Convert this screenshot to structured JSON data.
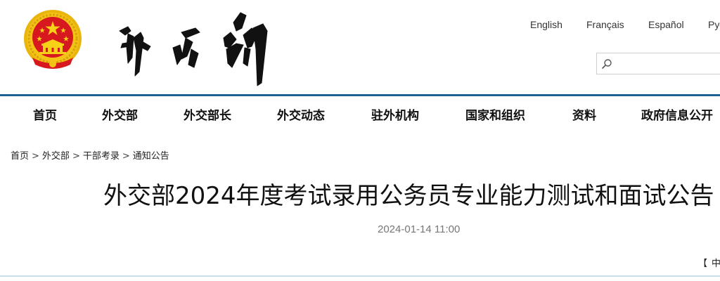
{
  "header": {
    "languages": [
      {
        "label": "English"
      },
      {
        "label": "Français"
      },
      {
        "label": "Español"
      },
      {
        "label": "Русский"
      }
    ],
    "search": {
      "placeholder": "",
      "value": ""
    }
  },
  "nav": {
    "items": [
      {
        "label": "首页"
      },
      {
        "label": "外交部"
      },
      {
        "label": "外交部长"
      },
      {
        "label": "外交动态"
      },
      {
        "label": "驻外机构"
      },
      {
        "label": "国家和组织"
      },
      {
        "label": "资料"
      },
      {
        "label": "政府信息公开"
      }
    ]
  },
  "breadcrumb": {
    "items": [
      {
        "label": "首页"
      },
      {
        "label": "外交部"
      },
      {
        "label": "干部考录"
      },
      {
        "label": "通知公告"
      }
    ],
    "separator": ">"
  },
  "article": {
    "title": "外交部2024年度考试录用公务员专业能力测试和面试公告",
    "date": "2024-01-14 11:00"
  },
  "font_size_control": {
    "bracket_open": "【",
    "medium_label": "中"
  },
  "colors": {
    "accent": "#1b6290",
    "emblem_red": "#d7191f",
    "emblem_gold": "#f3c316"
  },
  "icons": {
    "emblem": "national-emblem-icon",
    "calligraphy": "ministry-calligraphy-logo",
    "search": "search-icon"
  }
}
